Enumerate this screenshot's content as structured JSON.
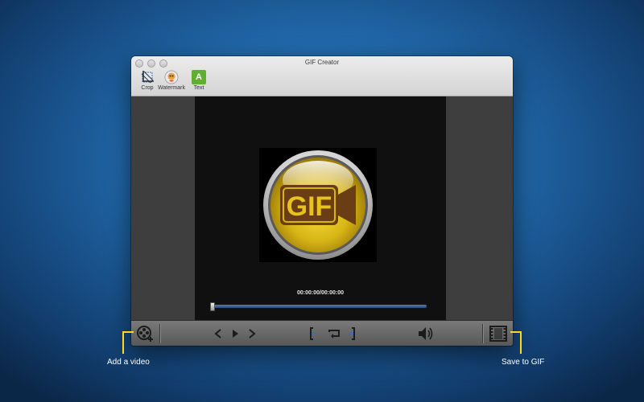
{
  "window": {
    "title": "GIF Creator"
  },
  "toolbar_top": {
    "crop_label": "Crop",
    "watermark_label": "Watermark",
    "text_label": "Text",
    "text_icon_glyph": "A"
  },
  "player": {
    "logo_text": "GIF",
    "timecode": "00:00:00/00:00:00",
    "progress": 0.0
  },
  "callouts": {
    "add_video": "Add a video",
    "save_gif": "Save to GIF"
  },
  "colors": {
    "accent_callout": "#ffd81f",
    "text_icon_bg": "#5fb030",
    "logo_gold": "#e6c21e",
    "logo_brown": "#6b3d14"
  },
  "icons": [
    "crop-icon",
    "watermark-icon",
    "text-icon",
    "add-video-icon",
    "previous-icon",
    "play-icon",
    "next-icon",
    "mark-in-icon",
    "loop-icon",
    "mark-out-icon",
    "volume-icon",
    "save-gif-icon"
  ]
}
